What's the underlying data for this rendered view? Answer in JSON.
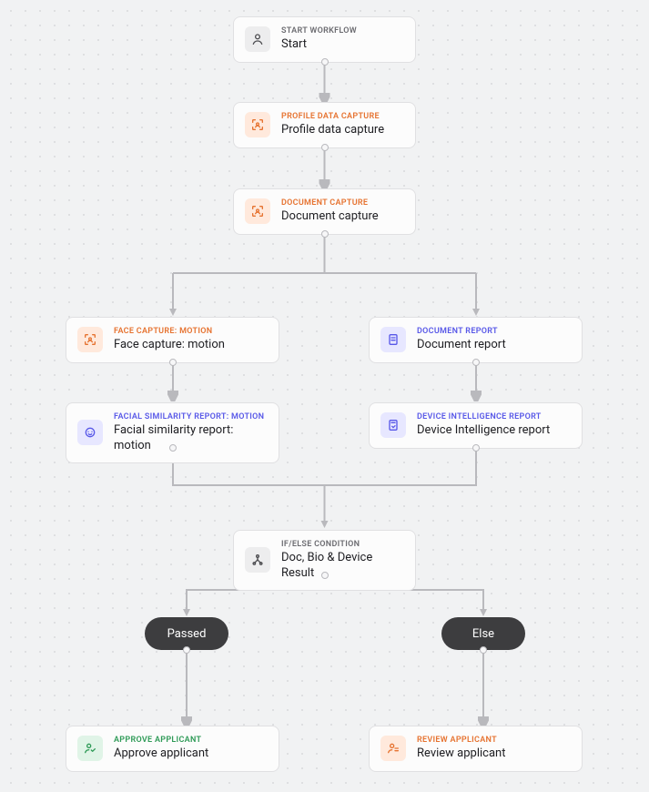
{
  "nodes": {
    "start": {
      "overline": "START WORKFLOW",
      "title": "Start"
    },
    "profile": {
      "overline": "PROFILE DATA CAPTURE",
      "title": "Profile data capture"
    },
    "doccap": {
      "overline": "DOCUMENT CAPTURE",
      "title": "Document capture"
    },
    "facecap": {
      "overline": "FACE CAPTURE: MOTION",
      "title": "Face capture: motion"
    },
    "docrep": {
      "overline": "DOCUMENT REPORT",
      "title": "Document report"
    },
    "facesim": {
      "overline": "FACIAL SIMILARITY REPORT: MOTION",
      "title": "Facial similarity report: motion"
    },
    "devint": {
      "overline": "DEVICE INTELLIGENCE REPORT",
      "title": "Device Intelligence report"
    },
    "cond": {
      "overline": "IF/ELSE CONDITION",
      "title": "Doc, Bio & Device Result"
    },
    "approve": {
      "overline": "APPROVE APPLICANT",
      "title": "Approve applicant"
    },
    "review": {
      "overline": "REVIEW APPLICANT",
      "title": "Review applicant"
    }
  },
  "pills": {
    "passed": "Passed",
    "else": "Else"
  },
  "colors": {
    "gray": "#6b6b70",
    "orange": "#e6722f",
    "indigo": "#5858e8",
    "green": "#2d9a56",
    "pillBg": "#3d3d3f",
    "edge": "#b9b9bd"
  }
}
